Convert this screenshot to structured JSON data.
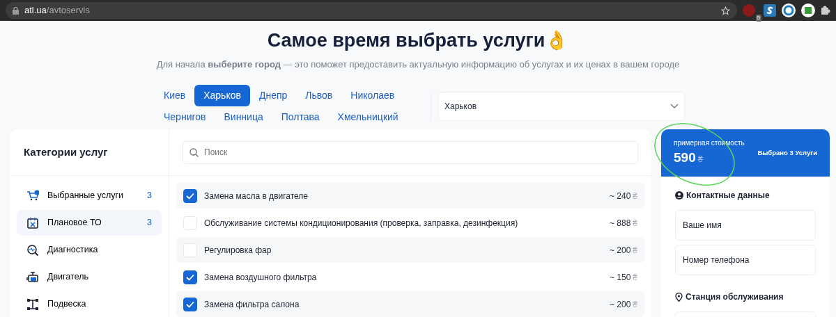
{
  "browser": {
    "url_host": "atl.ua",
    "url_path": "/avtoservis",
    "extension_badge": "5"
  },
  "header": {
    "title": "Самое время выбрать услуги👌",
    "subtitle": "Для начала **выберите город** — это поможет предоставить актуальную информацию об услугах и их ценах в вашем городе"
  },
  "cities": [
    {
      "label": "Киев",
      "selected": false
    },
    {
      "label": "Харьков",
      "selected": true
    },
    {
      "label": "Днепр",
      "selected": false
    },
    {
      "label": "Львов",
      "selected": false
    },
    {
      "label": "Николаев",
      "selected": false
    },
    {
      "label": "Чернигов",
      "selected": false
    },
    {
      "label": "Винница",
      "selected": false
    },
    {
      "label": "Полтава",
      "selected": false
    },
    {
      "label": "Хмельницкий",
      "selected": false
    }
  ],
  "city_select": {
    "value": "Харьков"
  },
  "categories": {
    "title": "Категории услуг",
    "items": [
      {
        "label": "Выбранные услуги",
        "count": "3",
        "selected": false
      },
      {
        "label": "Плановое ТО",
        "count": "3",
        "selected": true
      },
      {
        "label": "Диагностика",
        "selected": false
      },
      {
        "label": "Двигатель",
        "selected": false
      },
      {
        "label": "Подвеска",
        "selected": false
      }
    ]
  },
  "search": {
    "placeholder": "Поиск"
  },
  "services": [
    {
      "name": "Замена масла в двигателе",
      "price": "~ 240",
      "currency": "₴",
      "checked": true
    },
    {
      "name": "Обслуживание системы кондиционирования (проверка, заправка, дезинфекция)",
      "price": "~ 888",
      "currency": "₴",
      "checked": false
    },
    {
      "name": "Регулировка фар",
      "price": "~ 200",
      "currency": "₴",
      "checked": false
    },
    {
      "name": "Замена воздушного фильтра",
      "price": "~ 150",
      "currency": "₴",
      "checked": true
    },
    {
      "name": "Замена фильтра салона",
      "price": "~ 200",
      "currency": "₴",
      "checked": true
    }
  ],
  "summary": {
    "label": "примерная стоимость",
    "total": "590",
    "currency": "₴",
    "selected_count": "Выбрано 3 Услуги"
  },
  "contact": {
    "title": "Контактные данные",
    "fields": [
      {
        "placeholder": "Ваше имя"
      },
      {
        "placeholder": "Номер телефона"
      }
    ]
  },
  "station": {
    "title": "Станция обслуживания"
  }
}
